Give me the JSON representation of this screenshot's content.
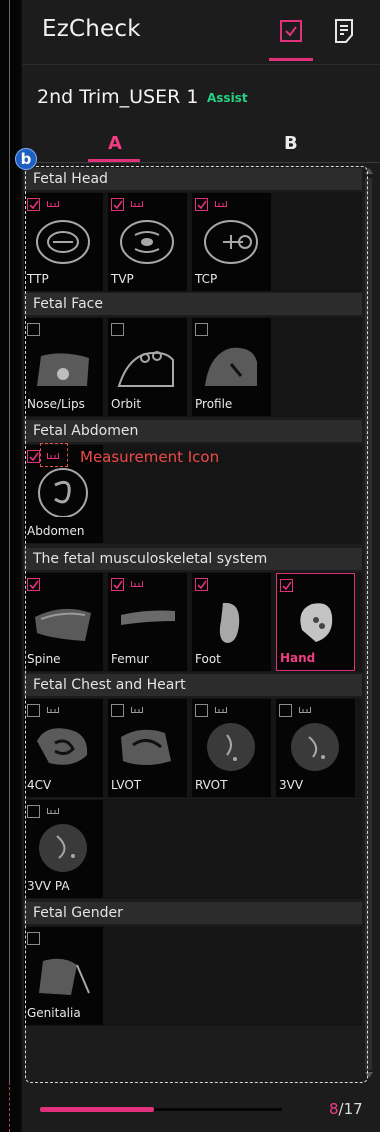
{
  "app_title": "EzCheck",
  "header_icons": [
    "checklist-icon",
    "document-icon"
  ],
  "protocol": {
    "name": "2nd Trim_USER 1",
    "badge": "Assist"
  },
  "tabs": [
    {
      "label": "A",
      "active": true
    },
    {
      "label": "B",
      "active": false
    }
  ],
  "annotations": {
    "badge": "b",
    "measurement_label": "Measurement Icon"
  },
  "sections": [
    {
      "title": "Fetal Head",
      "items": [
        {
          "label": "TTP",
          "checked": true,
          "measure": true
        },
        {
          "label": "TVP",
          "checked": true,
          "measure": true
        },
        {
          "label": "TCP",
          "checked": true,
          "measure": true
        }
      ]
    },
    {
      "title": "Fetal Face",
      "items": [
        {
          "label": "Nose/Lips",
          "checked": false,
          "measure": false
        },
        {
          "label": "Orbit",
          "checked": false,
          "measure": false
        },
        {
          "label": "Profile",
          "checked": false,
          "measure": false
        }
      ]
    },
    {
      "title": "Fetal Abdomen",
      "items": [
        {
          "label": "Abdomen",
          "checked": true,
          "measure": true
        }
      ]
    },
    {
      "title": "The fetal musculoskeletal system",
      "items": [
        {
          "label": "Spine",
          "checked": true,
          "measure": false
        },
        {
          "label": "Femur",
          "checked": true,
          "measure": true
        },
        {
          "label": "Foot",
          "checked": true,
          "measure": false
        },
        {
          "label": "Hand",
          "checked": true,
          "measure": false,
          "selected": true
        }
      ]
    },
    {
      "title": "Fetal Chest and Heart",
      "items": [
        {
          "label": "4CV",
          "checked": false,
          "measure": true
        },
        {
          "label": "LVOT",
          "checked": false,
          "measure": true
        },
        {
          "label": "RVOT",
          "checked": false,
          "measure": true
        },
        {
          "label": "3VV",
          "checked": false,
          "measure": true
        },
        {
          "label": "3VV PA",
          "checked": false,
          "measure": true
        }
      ]
    },
    {
      "title": "Fetal Gender",
      "items": [
        {
          "label": "Genitalia",
          "checked": false,
          "measure": false
        }
      ]
    }
  ],
  "progress": {
    "current": "8",
    "total": "/17",
    "fraction": 0.47
  },
  "colors": {
    "accent": "#e0317a",
    "assist": "#25d183",
    "annotation": "#ef4a4a",
    "badge": "#1e5fbf"
  }
}
